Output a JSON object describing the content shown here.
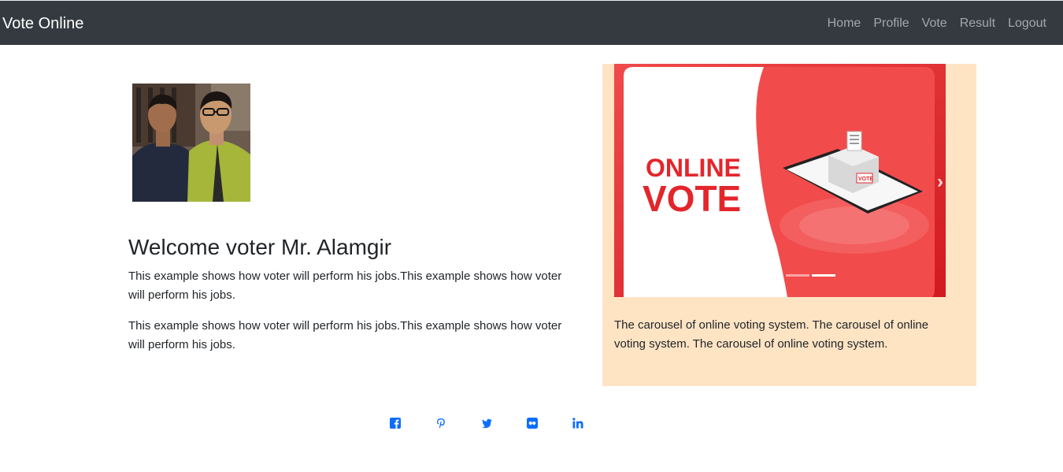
{
  "navbar": {
    "brand": "Vote Online",
    "links": [
      "Home",
      "Profile",
      "Vote",
      "Result",
      "Logout"
    ]
  },
  "main": {
    "welcome": "Welcome voter Mr. Alamgir",
    "paragraphs": [
      "This example shows how voter will perform his jobs.This example shows how voter will perform his jobs.",
      "This example shows how voter will perform his jobs.This example shows how voter will perform his jobs."
    ]
  },
  "carousel": {
    "slide_text_line1": "ONLINE",
    "slide_text_line2": "VOTE",
    "ballot_label": "VOTE",
    "caption": "The carousel of online voting system. The carousel of online voting system. The carousel of online voting system."
  },
  "social": [
    "facebook-icon",
    "pinterest-icon",
    "twitter-icon",
    "flickr-icon",
    "linkedin-icon"
  ],
  "colors": {
    "navbar_bg": "#343a40",
    "panel_bg": "#ffe4c4",
    "vote_red": "#e3262c",
    "link_blue": "#0d6efd"
  }
}
